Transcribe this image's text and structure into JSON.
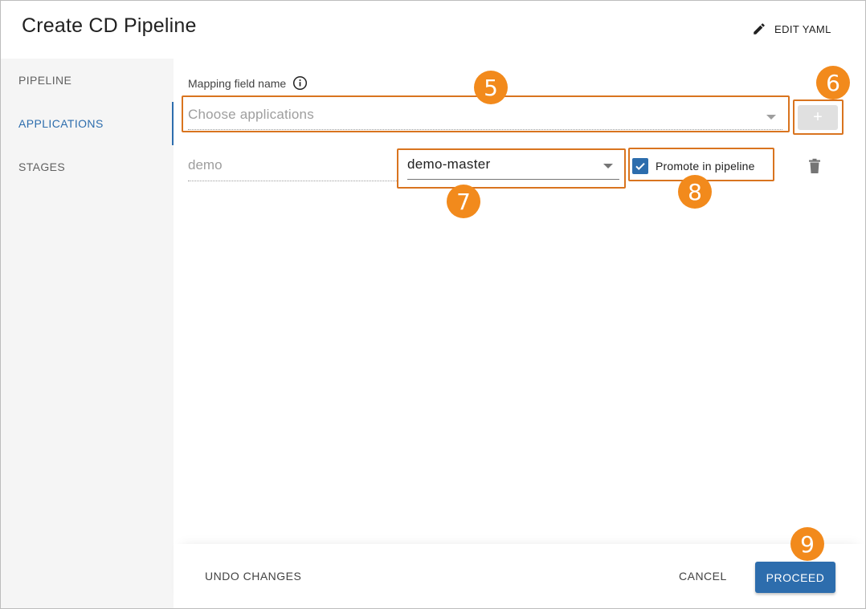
{
  "dialog": {
    "title": "Create CD Pipeline",
    "edit_yaml_label": "EDIT YAML"
  },
  "sidebar": {
    "items": [
      {
        "label": "PIPELINE",
        "active": false
      },
      {
        "label": "APPLICATIONS",
        "active": true
      },
      {
        "label": "STAGES",
        "active": false
      }
    ]
  },
  "applications_form": {
    "mapping_field_label": "Mapping field name",
    "choose_placeholder": "Choose applications",
    "add_button_icon": "plus-icon",
    "rows": [
      {
        "app_name": "demo",
        "branch_value": "demo-master",
        "promote_label": "Promote in pipeline",
        "promote_checked": true
      }
    ]
  },
  "callouts": {
    "badge_5": "5",
    "badge_6": "6",
    "badge_7": "7",
    "badge_8": "8",
    "badge_9": "9"
  },
  "footer": {
    "undo_label": "UNDO CHANGES",
    "cancel_label": "CANCEL",
    "proceed_label": "PROCEED"
  },
  "colors": {
    "accent": "#2d6dad",
    "callout_border": "#d9741f",
    "badge_fill": "#f28a1c",
    "sidebar_bg": "#f5f5f5"
  }
}
